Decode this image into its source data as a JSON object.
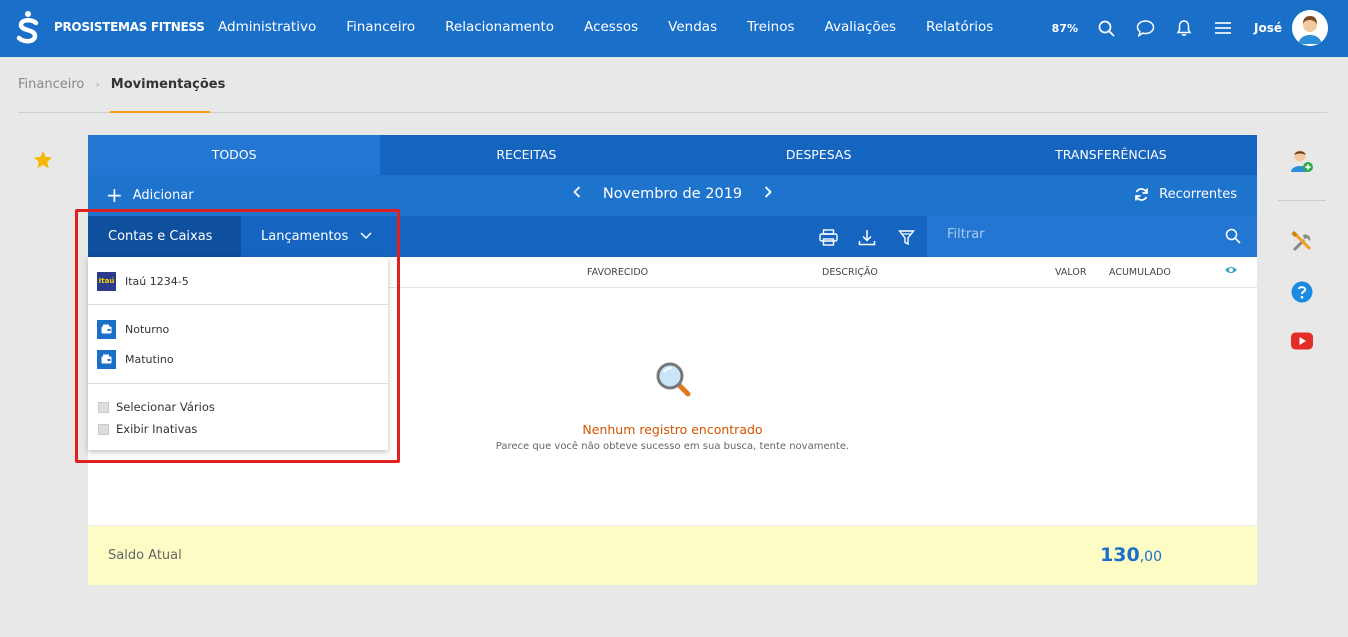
{
  "app": {
    "brand": "PROSISTEMAS FITNESS",
    "zoom": "87%",
    "user": "José"
  },
  "nav": [
    {
      "label": "Administrativo"
    },
    {
      "label": "Financeiro"
    },
    {
      "label": "Relacionamento"
    },
    {
      "label": "Acessos"
    },
    {
      "label": "Vendas"
    },
    {
      "label": "Treinos"
    },
    {
      "label": "Avaliações"
    },
    {
      "label": "Relatórios"
    }
  ],
  "breadcrumb": {
    "parent": "Financeiro",
    "current": "Movimentações"
  },
  "tabs": [
    {
      "label": "TODOS"
    },
    {
      "label": "RECEITAS"
    },
    {
      "label": "DESPESAS"
    },
    {
      "label": "TRANSFERÊNCIAS"
    }
  ],
  "toolbar": {
    "add_label": "Adicionar",
    "month": "Novembro de 2019",
    "recurrent_label": "Recorrentes",
    "accounts_label": "Contas e Caixas",
    "entries_label": "Lançamentos",
    "filter_placeholder": "Filtrar"
  },
  "table": {
    "columns": [
      "FAVORECIDO",
      "DESCRIÇÃO",
      "VALOR",
      "ACUMULADO"
    ]
  },
  "empty": {
    "title": "Nenhum registro encontrado",
    "subtitle": "Parece que você não obteve sucesso em sua busca, tente novamente."
  },
  "saldo": {
    "label": "Saldo Atual",
    "integer": "130",
    "cents": ",00"
  },
  "dropdown": {
    "bank": {
      "icon_text": "Itaú",
      "label": "Itaú 1234-5"
    },
    "cashboxes": [
      {
        "label": "Noturno"
      },
      {
        "label": "Matutino"
      }
    ],
    "options": [
      {
        "label": "Selecionar Vários"
      },
      {
        "label": "Exibir Inativas"
      }
    ]
  },
  "colors": {
    "primary": "#1a6fc9",
    "accent": "#f39c12",
    "empty_title": "#d35400",
    "saldo_bg": "#fdfcc5"
  }
}
